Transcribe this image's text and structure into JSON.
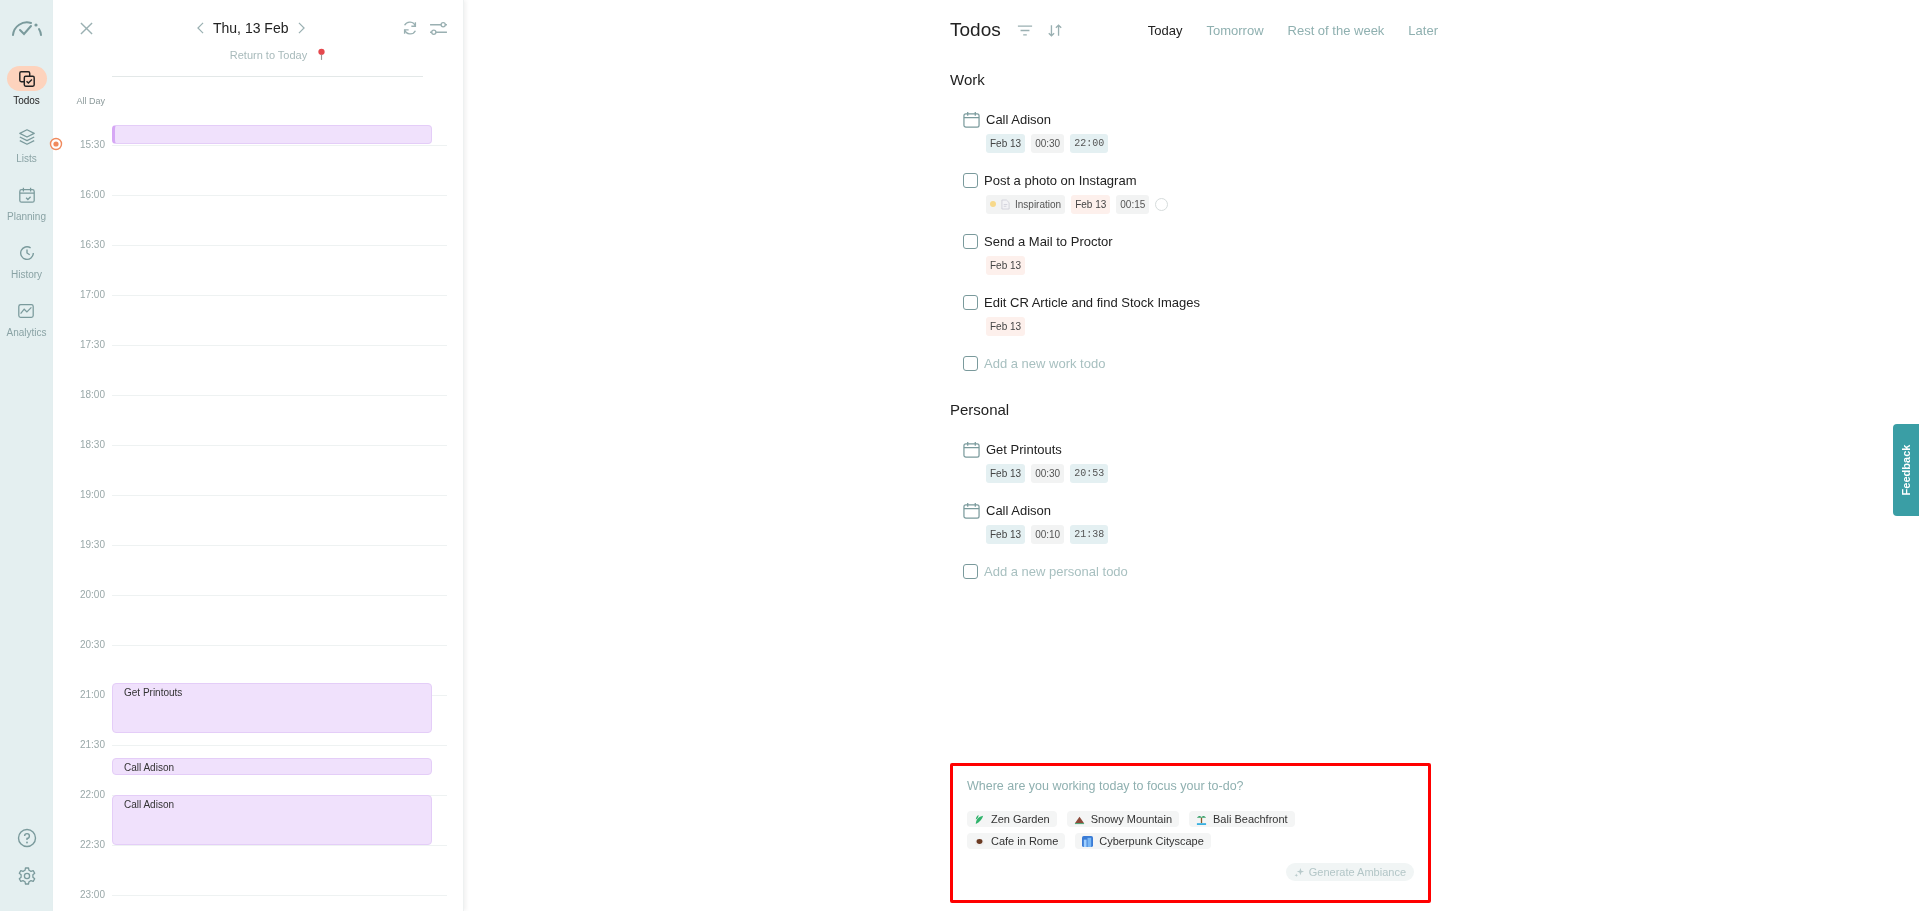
{
  "nav": {
    "items": [
      {
        "label": "Todos",
        "selected": true
      },
      {
        "label": "Lists",
        "selected": false
      },
      {
        "label": "Planning",
        "selected": false
      },
      {
        "label": "History",
        "selected": false
      },
      {
        "label": "Analytics",
        "selected": false
      }
    ]
  },
  "calendar": {
    "date": "Thu, 13 Feb",
    "return_link": "Return to Today",
    "all_day_label": "All Day",
    "times": [
      "15:30",
      "16:00",
      "16:30",
      "17:00",
      "17:30",
      "18:00",
      "18:30",
      "19:00",
      "19:30",
      "20:00",
      "20:30",
      "21:00",
      "21:30",
      "22:00",
      "22:30",
      "23:00"
    ],
    "events": [
      {
        "title": "Get Printouts"
      },
      {
        "title": "Call Adison"
      },
      {
        "title": "Call Adison"
      }
    ]
  },
  "todos": {
    "title": "Todos",
    "tabs": [
      {
        "label": "Today",
        "selected": true
      },
      {
        "label": "Tomorrow",
        "selected": false
      },
      {
        "label": "Rest of the week",
        "selected": false
      },
      {
        "label": "Later",
        "selected": false
      }
    ],
    "sections": [
      {
        "title": "Work",
        "add_placeholder": "Add a new work todo",
        "add_checked": false,
        "items": [
          {
            "title": "Call Adison",
            "scheduled": true,
            "chips": [
              {
                "kind": "date",
                "text": "Feb 13"
              },
              {
                "kind": "duration",
                "text": "00:30"
              },
              {
                "kind": "time",
                "text": "22:00"
              }
            ]
          },
          {
            "title": "Post a photo on Instagram",
            "scheduled": false,
            "chips": [
              {
                "kind": "list",
                "text": "Inspiration",
                "color": "#f7d98b"
              },
              {
                "kind": "date",
                "text": "Feb 13"
              },
              {
                "kind": "duration",
                "text": "00:15"
              },
              {
                "kind": "ring"
              }
            ]
          },
          {
            "title": "Send a Mail to Proctor",
            "scheduled": false,
            "chips": [
              {
                "kind": "date",
                "text": "Feb 13"
              }
            ]
          },
          {
            "title": "Edit CR Article and find Stock Images",
            "scheduled": false,
            "chips": [
              {
                "kind": "date",
                "text": "Feb 13"
              }
            ]
          }
        ]
      },
      {
        "title": "Personal",
        "add_placeholder": "Add a new personal todo",
        "add_checked": false,
        "items": [
          {
            "title": "Get Printouts",
            "scheduled": true,
            "chips": [
              {
                "kind": "date",
                "text": "Feb 13"
              },
              {
                "kind": "duration",
                "text": "00:30"
              },
              {
                "kind": "time",
                "text": "20:53"
              }
            ]
          },
          {
            "title": "Call Adison",
            "scheduled": true,
            "chips": [
              {
                "kind": "date",
                "text": "Feb 13"
              },
              {
                "kind": "duration",
                "text": "00:10"
              },
              {
                "kind": "time",
                "text": "21:38"
              }
            ]
          }
        ]
      }
    ]
  },
  "ambiance": {
    "placeholder": "Where are you working today to focus your to-do?",
    "options": [
      {
        "label": "Zen Garden"
      },
      {
        "label": "Snowy Mountain"
      },
      {
        "label": "Bali Beachfront"
      },
      {
        "label": "Cafe in Rome"
      },
      {
        "label": "Cyberpunk Cityscape"
      }
    ],
    "button": "Generate Ambiance"
  },
  "feedback": "Feedback"
}
